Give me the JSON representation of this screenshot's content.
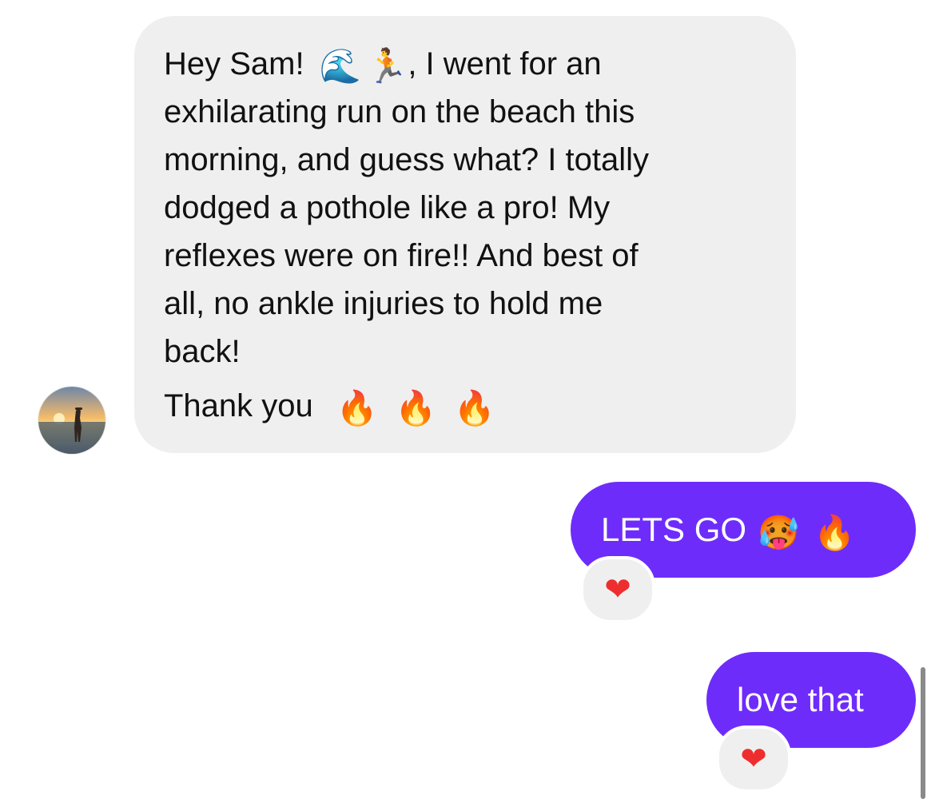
{
  "incoming_message": {
    "line_1_before_emoji": "Hey Sam!",
    "emoji_wave": "🌊",
    "emoji_runner": "🏃",
    "line_1_after_emoji": ", I went for an",
    "line_2": "exhilarating run on the beach this",
    "line_3": "morning, and guess what? I totally",
    "line_4": "dodged a pothole like a pro! My",
    "line_5": "reflexes were on fire!! And best of",
    "line_6": "all, no ankle injuries to hold me",
    "line_7": "back!",
    "thanks_text": "Thank you",
    "thanks_emojis": [
      "🔥",
      "🔥",
      "🔥"
    ],
    "bubble_color": "#efefef"
  },
  "outgoing_messages": [
    {
      "text": "LETS GO",
      "emojis": [
        "🥵",
        "🔥"
      ],
      "reaction": "❤"
    },
    {
      "text": "love that",
      "emojis": [],
      "reaction": "❤"
    }
  ],
  "colors": {
    "outgoing_bubble": "#6e2cfb",
    "reaction_heart": "#ee2e2e"
  }
}
